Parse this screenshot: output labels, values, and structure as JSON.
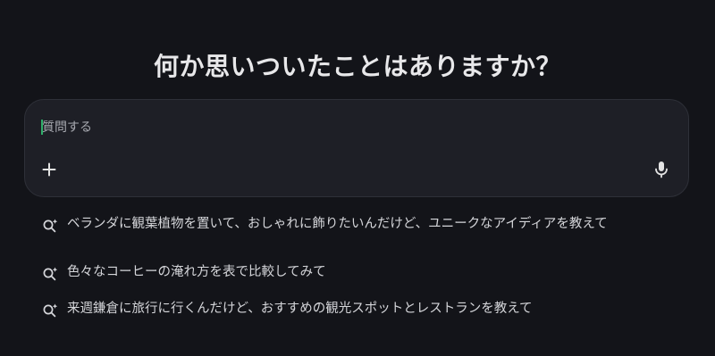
{
  "headline": "何か思いついたことはありますか？",
  "composer": {
    "placeholder": "質問する",
    "value": "",
    "add_icon": "plus-icon",
    "mic_icon": "microphone-icon"
  },
  "suggestions": [
    {
      "icon": "spark-search-icon",
      "label": "ベランダに観葉植物を置いて、おしゃれに飾りたいんだけど、ユニークなアイディアを教えて"
    },
    {
      "icon": "spark-search-icon",
      "label": "色々なコーヒーの淹れ方を表で比較してみて"
    },
    {
      "icon": "spark-search-icon",
      "label": "来週鎌倉に旅行に行くんだけど、おすすめの観光スポットとレストランを教えて"
    }
  ],
  "colors": {
    "background": "#131419",
    "composer_bg": "#1e1f26",
    "caret": "#2fae6a",
    "text": "#e3e3e3"
  }
}
